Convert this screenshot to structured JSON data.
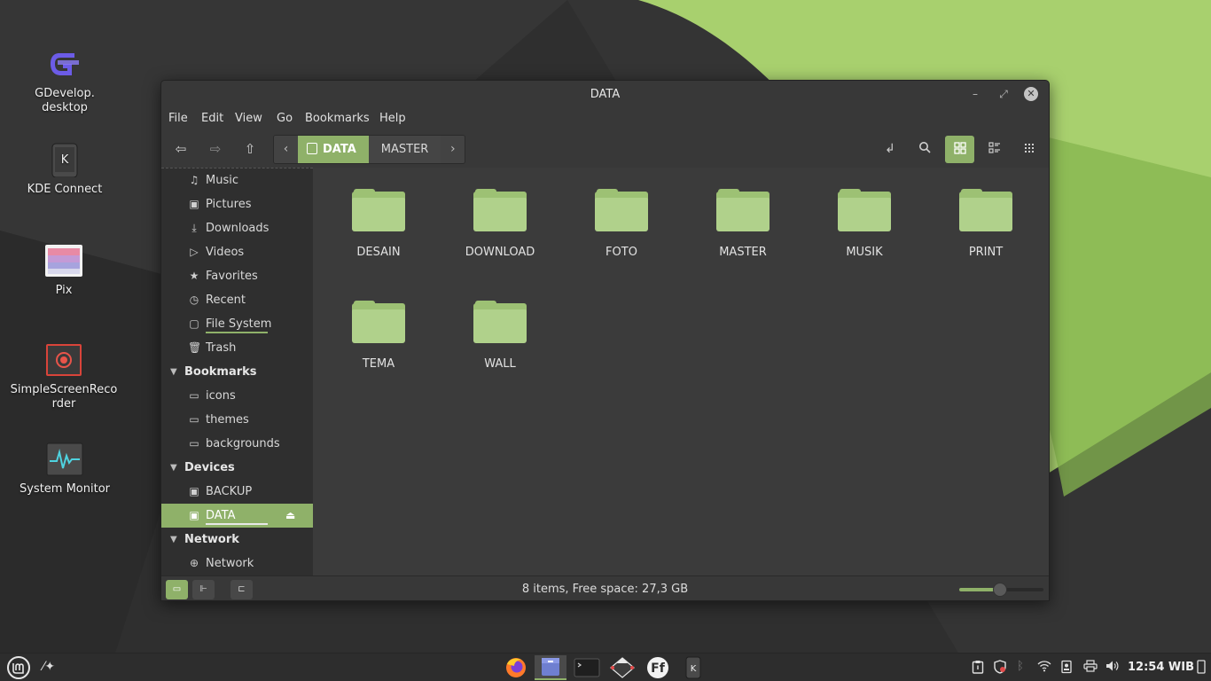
{
  "desktop": {
    "icons": [
      {
        "label": "GDevelop.\ndesktop"
      },
      {
        "label": "KDE Connect"
      },
      {
        "label": "Pix"
      },
      {
        "label": "SimpleScreenReco\nrder"
      },
      {
        "label": "System Monitor"
      }
    ]
  },
  "window": {
    "title": "DATA",
    "menu": [
      "File",
      "Edit",
      "View",
      "Go",
      "Bookmarks",
      "Help"
    ],
    "pathbar": {
      "segments": [
        "DATA",
        "MASTER"
      ],
      "active": "DATA"
    },
    "sidebar": {
      "places": [
        "Music",
        "Pictures",
        "Downloads",
        "Videos",
        "Favorites",
        "Recent",
        "File System",
        "Trash"
      ],
      "bookmarks_header": "Bookmarks",
      "bookmarks": [
        "icons",
        "themes",
        "backgrounds"
      ],
      "devices_header": "Devices",
      "devices": [
        "BACKUP",
        "DATA"
      ],
      "network_header": "Network",
      "network": [
        "Network"
      ]
    },
    "folders": [
      "DESAIN",
      "DOWNLOAD",
      "FOTO",
      "MASTER",
      "MUSIK",
      "PRINT",
      "TEMA",
      "WALL"
    ],
    "status": "8 items, Free space: 27,3 GB",
    "zoom_level": 0.48,
    "accent_color": "#8fb169"
  },
  "taskbar": {
    "clock": "12:54 WIB"
  }
}
